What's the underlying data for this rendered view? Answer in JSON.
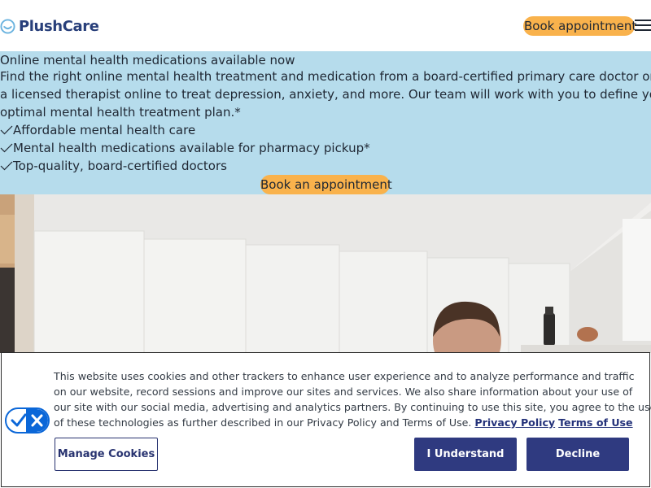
{
  "header": {
    "logo_text": "PlushCare",
    "book_label": "Book appointment",
    "menu_icon": "hamburger-menu-icon"
  },
  "hero": {
    "headline": "Online mental health medications available now",
    "description_lines": [
      "Find the right online mental health treatment and medication from a board-certified primary care doctor or",
      "a licensed therapist online to treat depression, anxiety, and more. Our team will work with you to define your",
      "optimal mental health treatment plan.*"
    ],
    "benefits": [
      "Affordable mental health care",
      "Mental health medications available for pharmacy pickup*",
      "Top-quality, board-certified doctors"
    ],
    "cta_label": "Book an appointment",
    "check_icon": "check-icon"
  },
  "cookie_banner": {
    "text_lines": [
      "This website uses cookies and other trackers to enhance user experience and to analyze performance and traffic",
      "on our website, record sessions and improve our sites and services. We also share information about your use of",
      "our site with our social media, advertising and analytics partners. By continuing to use this site, you agree to the use",
      "of these technologies as further described in our Privacy Policy and Terms of Use."
    ],
    "privacy_policy_link": "Privacy Policy",
    "terms_link": "Terms of Use",
    "manage_label": "Manage Cookies",
    "understand_label": "I Understand",
    "decline_label": "Decline",
    "privacy_toggle_icon": "privacy-choices-icon"
  },
  "colors": {
    "brand_navy": "#283f7a",
    "cta_orange": "#f9b24c",
    "hero_blue": "#b6dcec",
    "button_navy": "#2f3a80",
    "toggle_blue": "#0b67d8"
  }
}
